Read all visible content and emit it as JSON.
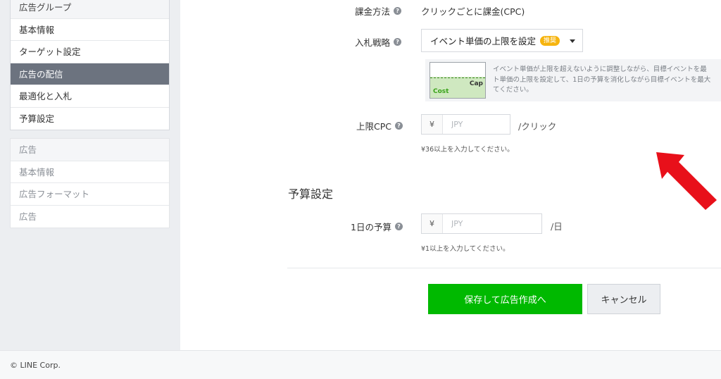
{
  "sidebar": {
    "group1": {
      "header": "広告グループ",
      "items": [
        "基本情報",
        "ターゲット設定",
        "広告の配信",
        "最適化と入札",
        "予算設定"
      ]
    },
    "group2": {
      "header": "広告",
      "items": [
        "基本情報",
        "広告フォーマット",
        "広告"
      ]
    }
  },
  "form": {
    "billing": {
      "label": "課金方法",
      "value": "クリックごとに課金(CPC)"
    },
    "bid_strategy": {
      "label": "入札戦略",
      "selected": "イベント単価の上限を設定",
      "badge": "推奨",
      "chart": {
        "cost_label": "Cost",
        "cap_label": "Cap"
      },
      "description": [
        "イベント単価が上限を超えないように調整しながら、目標イベントを最",
        "ト単価の上限を設定して、1日の予算を消化しながら目標イベントを最大",
        "てください。"
      ]
    },
    "cpc": {
      "label": "上限CPC",
      "currency": "¥",
      "placeholder": "JPY",
      "unit": "/クリック",
      "hint": "¥36以上を入力してください。"
    },
    "budget_section_title": "予算設定",
    "daily_budget": {
      "label": "1日の予算",
      "currency": "¥",
      "placeholder": "JPY",
      "unit": "/日",
      "hint": "¥1以上を入力してください。"
    }
  },
  "actions": {
    "save_label": "保存して広告作成へ",
    "cancel_label": "キャンセル"
  },
  "footer": {
    "copyright": "© LINE Corp."
  },
  "colors": {
    "primary_green": "#00b900",
    "active_nav": "#6c737f",
    "badge": "#f6b40e",
    "arrow": "#e8101a"
  },
  "icons": {
    "help": "help-circle-icon",
    "select": "chevron-down-icon",
    "annotation": "red-arrow-icon"
  }
}
